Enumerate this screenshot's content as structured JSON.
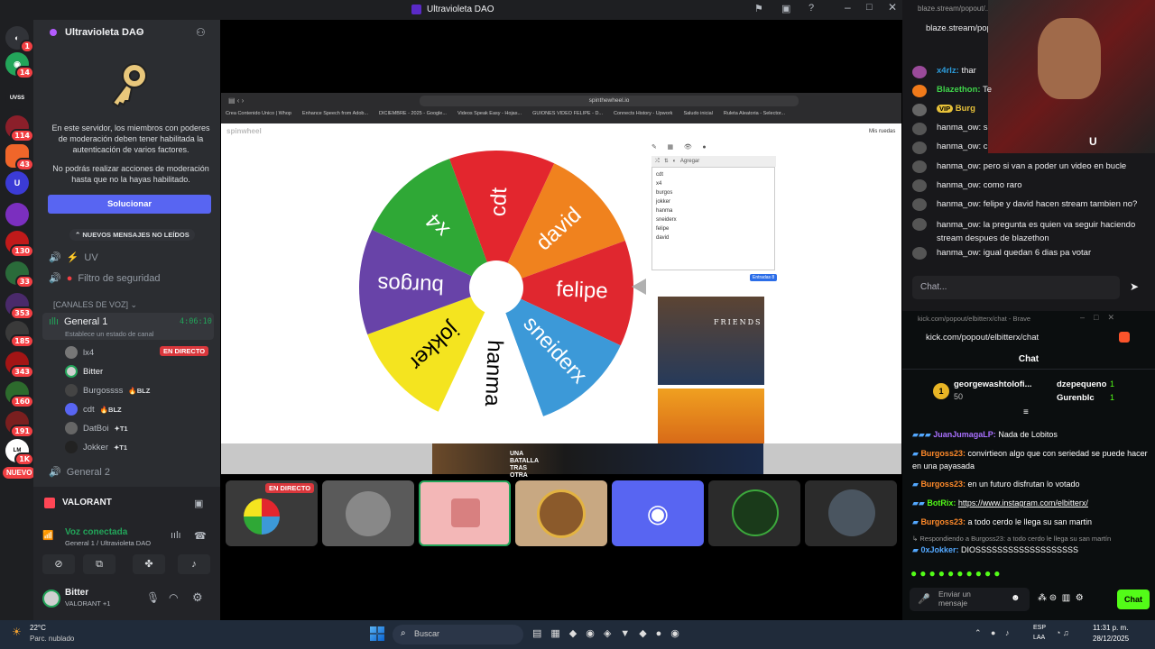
{
  "window": {
    "title": "Ultravioleta DAO"
  },
  "rail": {
    "badges": [
      "1",
      "14",
      "114",
      "43",
      "130",
      "33",
      "353",
      "185",
      "343",
      "160",
      "191",
      "1K"
    ],
    "new_label": "NUEVO"
  },
  "sidebar": {
    "server_name": "Ultravioleta DAO",
    "mfa_notice": "En este servidor, los miembros con poderes de moderación deben tener habilitada la autenticación de varios factores.",
    "mfa_notice2": "No podrás realizar acciones de moderación hasta que no la hayas habilitado.",
    "solve_button": "Solucionar",
    "new_messages": "NUEVOS MENSAJES NO LEÍDOS",
    "channels": [
      "UV",
      "Filtro de seguridad"
    ],
    "voice_header": "[CANALES DE VOZ]",
    "voice_channel": "General 1",
    "voice_timer": "4:06:10",
    "status_hint": "Establece un estado de canal",
    "members": [
      {
        "name": "lx4",
        "tag": "EN DIRECTO"
      },
      {
        "name": "Bitter",
        "tag": ""
      },
      {
        "name": "Burgossss",
        "tag": "BLZ"
      },
      {
        "name": "cdt",
        "tag": "BLZ"
      },
      {
        "name": "DatBoi",
        "tag": "T1"
      },
      {
        "name": "Jokker",
        "tag": "T1"
      }
    ],
    "voice_channel2": "General 2",
    "activity": "VALORANT",
    "voice_connected": "Voz conectada",
    "voice_location": "General 1 / Ultravioleta DAO",
    "me_name": "Bitter",
    "me_status": "VALORANT +1"
  },
  "browser": {
    "url": "spinthewheel.io",
    "bookmarks": [
      "Crea Contenido Único | Whop",
      "Enhance Speech from Adob...",
      "DICIEMBRE - 2025 - Google...",
      "Videos Speak Easy - Hojas...",
      "GUIONES VIDEO FELIPE - D...",
      "Connects History - Upwork",
      "Saludo inicial",
      "Ruleta Aleatoria - Selector..."
    ],
    "app_logo": "spinwheel",
    "menu": [
      "Mis ruedas"
    ],
    "entries_button": "Agregar",
    "entries": [
      "cdt",
      "x4",
      "burgos",
      "jokker",
      "hanma",
      "sneiderx",
      "felipe",
      "david"
    ],
    "entries_count": "Entradas 8",
    "ad_text": "FRIENDS",
    "banner_text": "UNA BATALLA TRAS OTRA"
  },
  "wheel": {
    "segments": [
      {
        "label": "cdt",
        "color": "#e3262e"
      },
      {
        "label": "david",
        "color": "#f0821e"
      },
      {
        "label": "felipe",
        "color": "#e0272f"
      },
      {
        "label": "sneiderx",
        "color": "#3c99d8"
      },
      {
        "label": "hanma",
        "color": "#ffffff"
      },
      {
        "label": "jokker",
        "color": "#f4e41f"
      },
      {
        "label": "burgos",
        "color": "#6843a8"
      },
      {
        "label": "x4",
        "color": "#2fa836"
      }
    ]
  },
  "tiles": {
    "live": "EN DIRECTO"
  },
  "stream": {
    "url": "blaze.stream/popout/...",
    "url2": "blaze.stream/pop",
    "messages": [
      {
        "user": "x4rlz:",
        "text": "thar"
      },
      {
        "user": "Blazethon:",
        "text": "Te"
      },
      {
        "user": "VIP",
        "text": "Burg"
      },
      {
        "user": "hanma_ow:",
        "text": "s"
      },
      {
        "user": "hanma_ow:",
        "text": "c"
      },
      {
        "user": "hanma_ow:",
        "text": "pero si van a poder un video en bucle"
      },
      {
        "user": "hanma_ow:",
        "text": "como raro"
      },
      {
        "user": "hanma_ow:",
        "text": "felipe y david hacen stream tambien no?"
      },
      {
        "user": "hanma_ow:",
        "text": "la pregunta es quien va seguir haciendo stream despues de blazethon"
      },
      {
        "user": "hanma_ow:",
        "text": "igual quedan 6 dias pa votar"
      }
    ],
    "chat_placeholder": "Chat..."
  },
  "kick": {
    "window_title": "kick.com/popout/elbitterx/chat - Brave",
    "url": "kick.com/popout/elbitterx/chat",
    "header": "Chat",
    "top": [
      {
        "name": "georgewashtolofi...",
        "score": "1",
        "gift": "50"
      },
      {
        "name": "dzepequeno",
        "score": "1"
      },
      {
        "name": "Gurenblc",
        "score": "1"
      }
    ],
    "messages": [
      {
        "user": "JuanJumagaLP:",
        "text": "Nada de Lobitos"
      },
      {
        "user": "Burgoss23:",
        "text": "convirtieon algo que con seriedad se puede hacer en una payasada"
      },
      {
        "user": "Burgoss23:",
        "text": "en un futuro disfrutan lo votado"
      },
      {
        "user": "BotRix:",
        "text": "https://www.instagram.com/elbitterx/"
      },
      {
        "user": "Burgoss23:",
        "text": "a todo cerdo le llega su san martin"
      }
    ],
    "reply_hint": "Respondiendo a Burgoss23: a todo cerdo le llega su san martín",
    "last_msg": {
      "user": "0xJokker:",
      "text": "DIOSSSSSSSSSSSSSSSSSSS"
    },
    "send_placeholder": "Enviar un mensaje",
    "send_button": "Chat"
  },
  "taskbar": {
    "temp": "22°C",
    "weather": "Parc. nublado",
    "search": "Buscar",
    "lang": "ESP",
    "lang2": "LAA",
    "time": "11:31 p. m.",
    "date": "28/12/2025"
  }
}
